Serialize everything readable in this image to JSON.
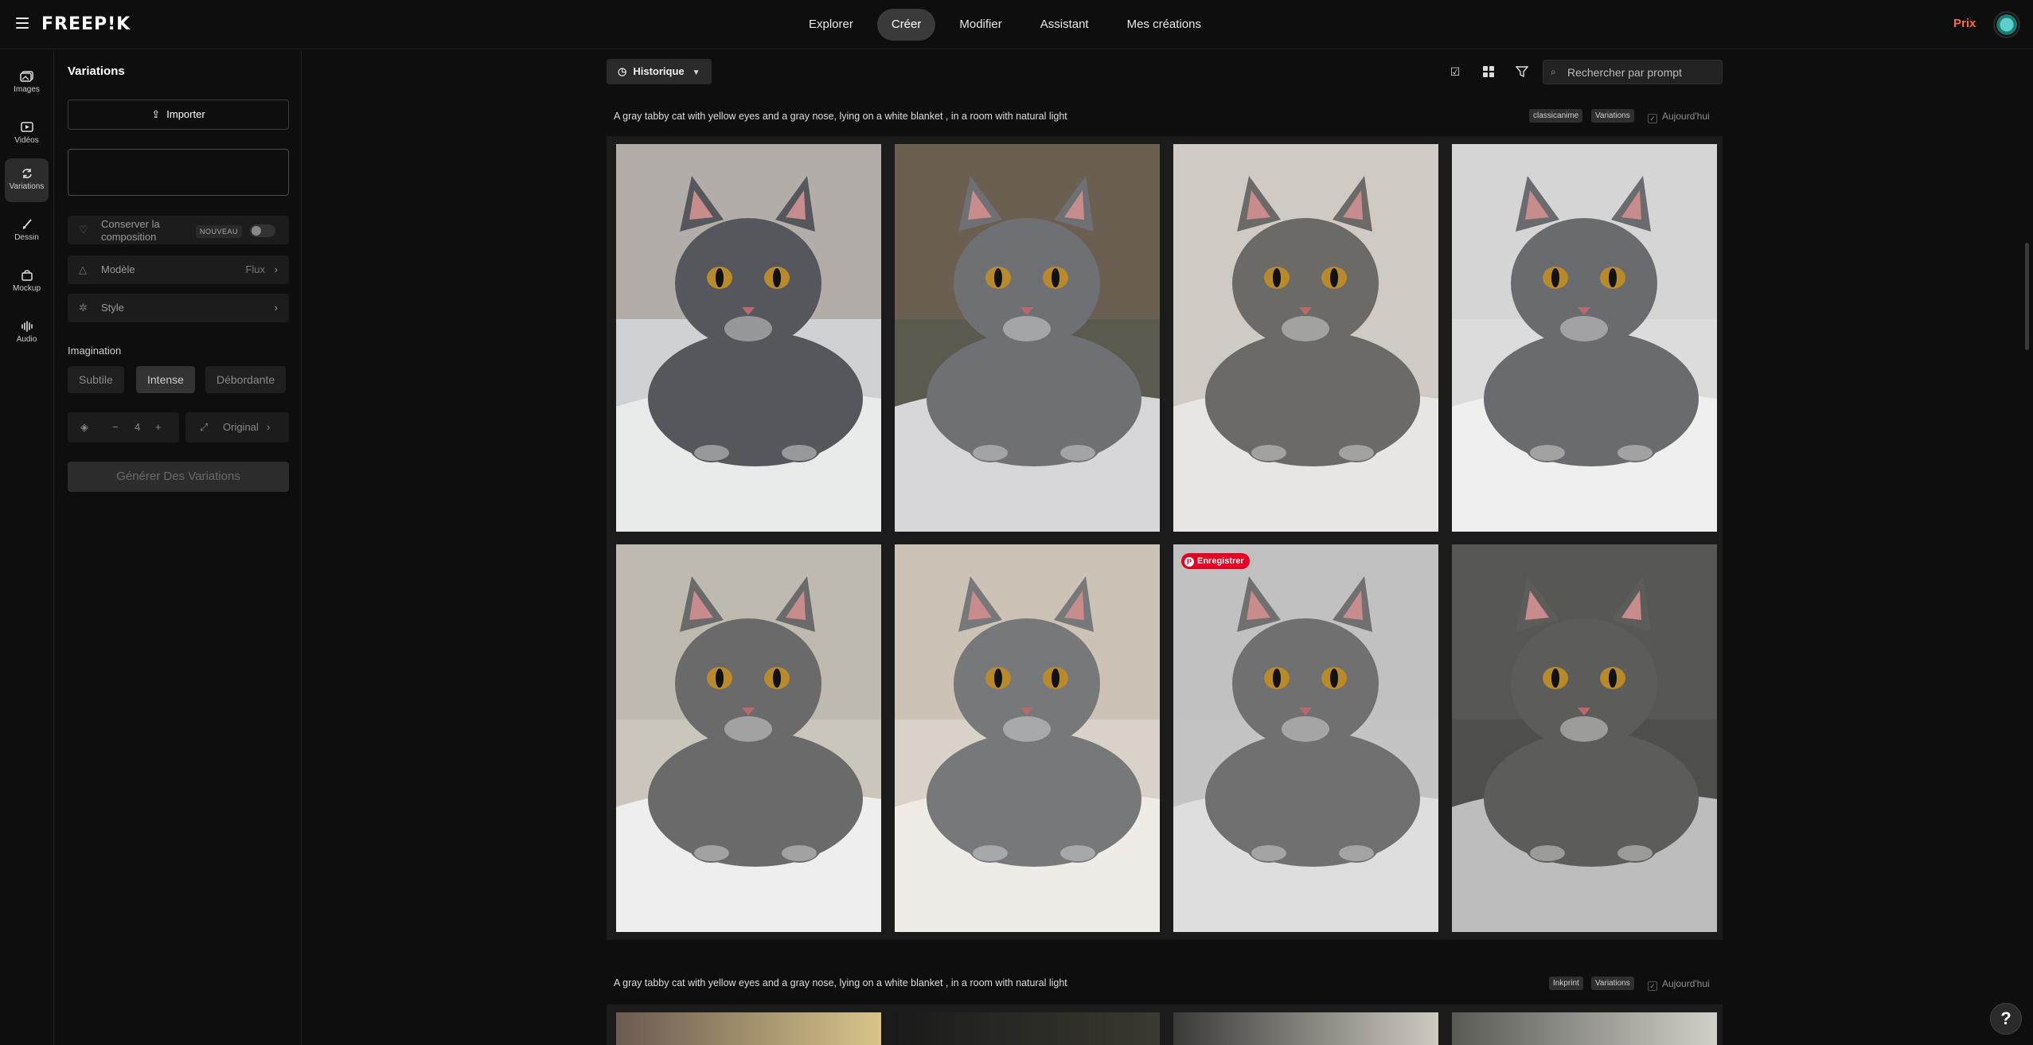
{
  "topbar": {
    "logo": "FREEP!K",
    "tabs": [
      {
        "label": "Explorer"
      },
      {
        "label": "Créer"
      },
      {
        "label": "Modifier"
      },
      {
        "label": "Assistant"
      },
      {
        "label": "Mes créations"
      }
    ],
    "active_tab": "Créer",
    "pricing": "Prix",
    "accent": "#ff6a3d"
  },
  "rail": {
    "items": [
      {
        "label": "Images",
        "icon": "images-icon"
      },
      {
        "label": "Vidéos",
        "icon": "video-icon"
      },
      {
        "label": "Variations",
        "icon": "variations-icon"
      },
      {
        "label": "Dessin",
        "icon": "brush-icon"
      },
      {
        "label": "Mockup",
        "icon": "mockup-icon"
      },
      {
        "label": "Audio",
        "icon": "audio-icon"
      }
    ],
    "active": "Variations"
  },
  "panel": {
    "title": "Variations",
    "import_label": "Importer",
    "keep_composition": "Conserver la composition",
    "new_badge": "NOUVEAU",
    "keep_composition_on": false,
    "model_label": "Modèle",
    "model_value": "Flux",
    "style_label": "Style",
    "imagination_label": "Imagination",
    "imagination_options": [
      "Subtile",
      "Intense",
      "Débordante"
    ],
    "imagination_selected": "Intense",
    "count": "4",
    "aspect": "Original",
    "generate_label": "Générer Des Variations"
  },
  "toolbar": {
    "history_label": "Historique",
    "search_placeholder": "Rechercher par prompt"
  },
  "groups": [
    {
      "prompt": "A gray tabby cat with yellow eyes and a gray nose, lying on a white blanket , in a room with natural light",
      "tags": [
        "classicanime",
        "Variations"
      ],
      "date": "Aujourd'hui",
      "save_badge": "Enregistrer"
    },
    {
      "prompt": "A gray tabby cat with yellow eyes and a gray nose, lying on a white blanket , in a room with natural light",
      "tags": [
        "Inkprint",
        "Variations"
      ],
      "date": "Aujourd'hui"
    }
  ],
  "help_label": "?"
}
